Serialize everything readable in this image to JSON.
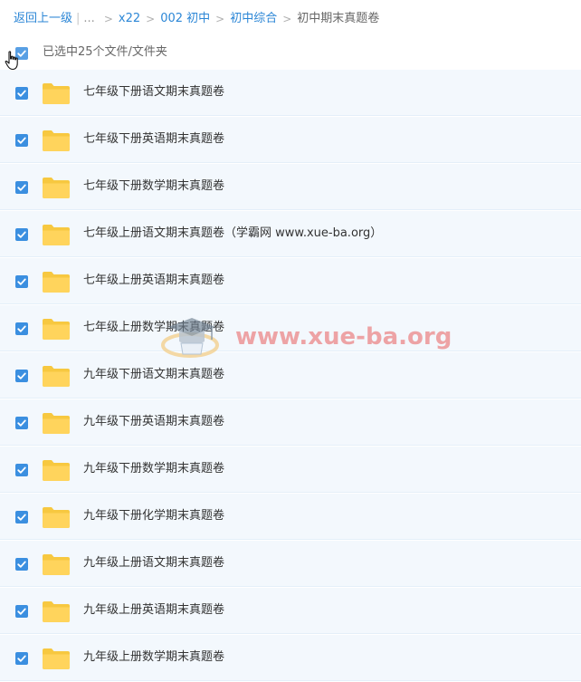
{
  "breadcrumb": {
    "back": "返回上一级",
    "ellipsis": "...",
    "items": [
      "x22",
      "002 初中",
      "初中综合",
      "初中期末真题卷"
    ]
  },
  "selection": {
    "label": "已选中25个文件/文件夹"
  },
  "files": [
    {
      "name": "七年级下册语文期末真题卷"
    },
    {
      "name": "七年级下册英语期末真题卷"
    },
    {
      "name": "七年级下册数学期末真题卷"
    },
    {
      "name": "七年级上册语文期末真题卷（学霸网 www.xue-ba.org）"
    },
    {
      "name": "七年级上册英语期末真题卷"
    },
    {
      "name": "七年级上册数学期末真题卷"
    },
    {
      "name": "九年级下册语文期末真题卷"
    },
    {
      "name": "九年级下册英语期末真题卷"
    },
    {
      "name": "九年级下册数学期末真题卷"
    },
    {
      "name": "九年级下册化学期末真题卷"
    },
    {
      "name": "九年级上册语文期末真题卷"
    },
    {
      "name": "九年级上册英语期末真题卷"
    },
    {
      "name": "九年级上册数学期末真题卷"
    }
  ],
  "watermark": {
    "text": "www.xue-ba.org"
  },
  "colors": {
    "link": "#2b86d6",
    "checkbox": "#3b8fe0",
    "folder": "#ffd45c",
    "row_bg": "#f3f8fd"
  },
  "icons": {
    "checkbox": "checkbox-checked-icon",
    "folder": "folder-icon",
    "cursor": "hand-cursor-icon",
    "logo": "graduation-cap-logo"
  }
}
